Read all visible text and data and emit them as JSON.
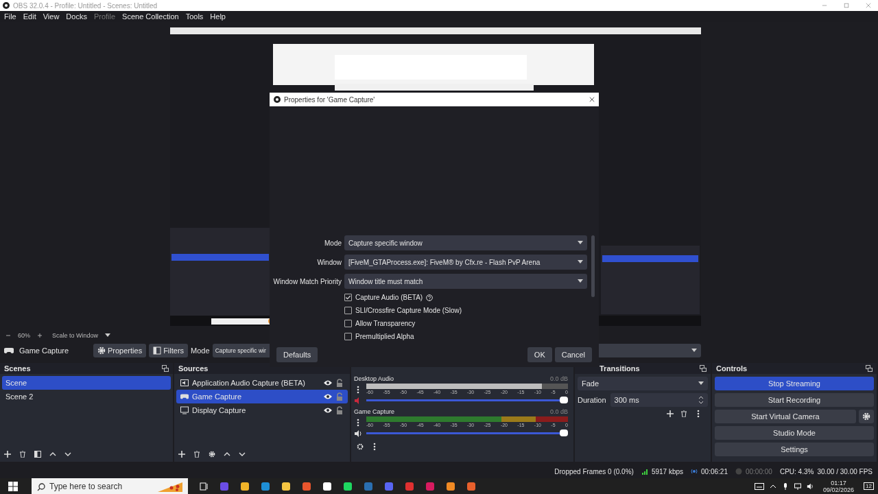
{
  "window": {
    "title": "OBS 32.0.4 - Profile: Untitled - Scenes: Untitled"
  },
  "menu": [
    {
      "label": "File",
      "disabled": false
    },
    {
      "label": "Edit",
      "disabled": false
    },
    {
      "label": "View",
      "disabled": false
    },
    {
      "label": "Docks",
      "disabled": false
    },
    {
      "label": "Profile",
      "disabled": true
    },
    {
      "label": "Scene Collection",
      "disabled": false
    },
    {
      "label": "Tools",
      "disabled": false
    },
    {
      "label": "Help",
      "disabled": false
    }
  ],
  "preview_bar": {
    "zoom": "60%",
    "scale": "Scale to Window"
  },
  "source_toolbar": {
    "source": "Game Capture",
    "properties": "Properties",
    "filters": "Filters",
    "mode_label": "Mode",
    "mode_value": "Capture specific wir"
  },
  "dialog": {
    "title": "Properties for 'Game Capture'",
    "fields": [
      {
        "label": "Mode",
        "value": "Capture specific window"
      },
      {
        "label": "Window",
        "value": "[FiveM_GTAProcess.exe]: FiveM® by Cfx.re - Flash PvP Arena"
      },
      {
        "label": "Window Match Priority",
        "value": "Window title must match"
      }
    ],
    "checkboxes": [
      {
        "label": "Capture Audio (BETA)",
        "checked": true,
        "help": true
      },
      {
        "label": "SLI/Crossfire Capture Mode (Slow)",
        "checked": false,
        "help": false
      },
      {
        "label": "Allow Transparency",
        "checked": false,
        "help": false
      },
      {
        "label": "Premultiplied Alpha",
        "checked": false,
        "help": false
      }
    ],
    "defaults": "Defaults",
    "ok": "OK",
    "cancel": "Cancel"
  },
  "scenes": {
    "title": "Scenes",
    "items": [
      {
        "name": "Scene",
        "selected": true
      },
      {
        "name": "Scene 2",
        "selected": false
      }
    ]
  },
  "sources": {
    "title": "Sources",
    "items": [
      {
        "name": "Application Audio Capture (BETA)",
        "kind": "audio",
        "selected": false
      },
      {
        "name": "Game Capture",
        "kind": "game",
        "selected": true
      },
      {
        "name": "Display Capture",
        "kind": "display",
        "selected": false
      }
    ]
  },
  "mixer": {
    "channels": [
      {
        "name": "Desktop Audio",
        "reading": "0.0 dB",
        "muted": true,
        "meter": {
          "level": 0.87
        },
        "volume": {
          "level": 1
        },
        "scale": [
          "-60",
          "-55",
          "-50",
          "-45",
          "-40",
          "-35",
          "-30",
          "-25",
          "-20",
          "-15",
          "-10",
          "-5",
          "0"
        ]
      },
      {
        "name": "Game Capture",
        "reading": "0.0 dB",
        "muted": false,
        "volume": {
          "level": 1
        },
        "scale": [
          "-60",
          "-55",
          "-50",
          "-45",
          "-40",
          "-35",
          "-30",
          "-25",
          "-20",
          "-15",
          "-10",
          "-5",
          "0"
        ]
      }
    ]
  },
  "transitions": {
    "title": "Transitions",
    "transition": "Fade",
    "duration_label": "Duration",
    "duration": "300 ms"
  },
  "controls": {
    "title": "Controls",
    "buttons": [
      {
        "label": "Stop Streaming",
        "active": true,
        "gear": false
      },
      {
        "label": "Start Recording",
        "active": false,
        "gear": false
      },
      {
        "label": "Start Virtual Camera",
        "active": false,
        "gear": true
      },
      {
        "label": "Studio Mode",
        "active": false,
        "gear": false
      },
      {
        "label": "Settings",
        "active": false,
        "gear": false
      }
    ]
  },
  "status_bar": {
    "dropped": "Dropped Frames 0 (0.0%)",
    "bitrate": "5917 kbps",
    "stream_time": "00:06:21",
    "record_time": "00:00:00",
    "cpu": "CPU: 4.3%",
    "fps": "30.00 / 30.00 FPS"
  },
  "taskbar": {
    "search_placeholder": "Type here to search",
    "time": "01:17",
    "date": "09/02/2026",
    "notifications": "12"
  }
}
